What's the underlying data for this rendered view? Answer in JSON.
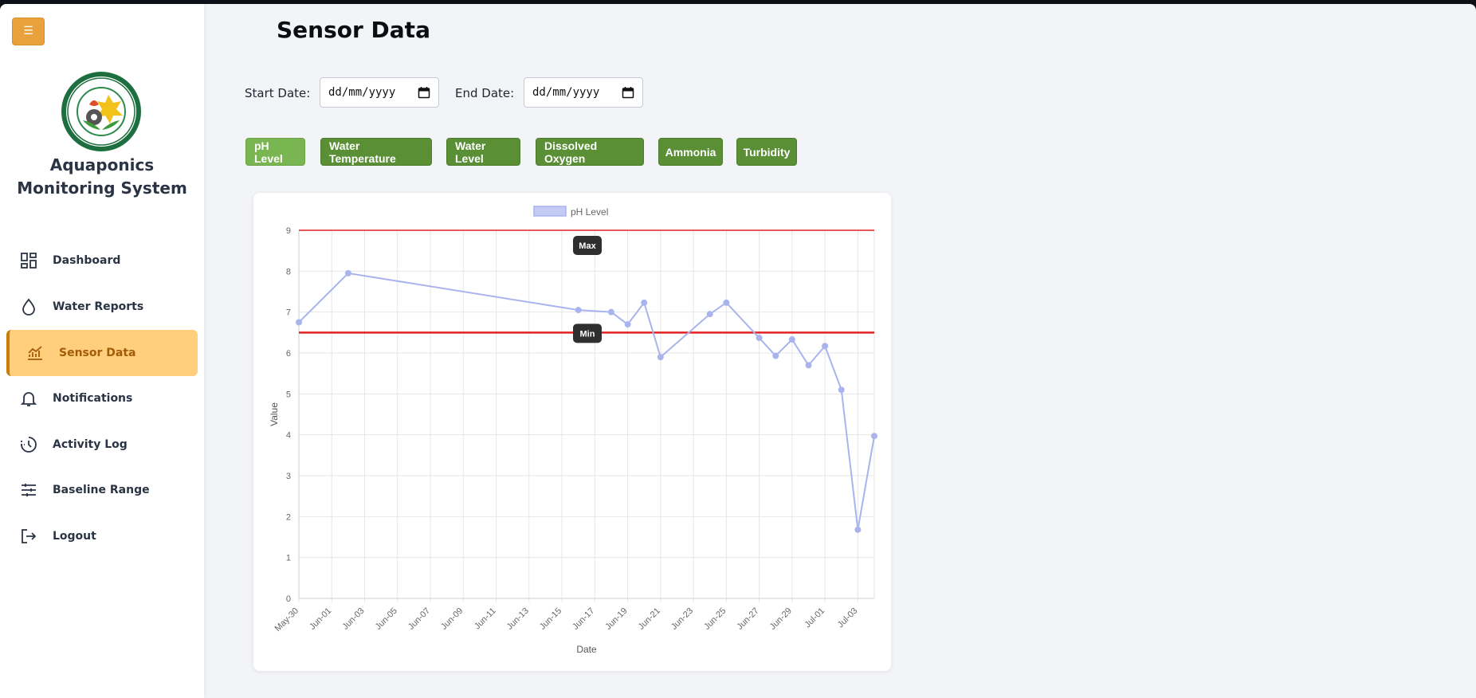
{
  "sidebar": {
    "toggle_glyph": "☰",
    "brand": "Aquaponics Monitoring System",
    "items": [
      {
        "label": "Dashboard",
        "icon": "dashboard-icon"
      },
      {
        "label": "Water Reports",
        "icon": "water-drop-icon"
      },
      {
        "label": "Sensor Data",
        "icon": "chart-icon",
        "active": true
      },
      {
        "label": "Notifications",
        "icon": "bell-icon"
      },
      {
        "label": "Activity Log",
        "icon": "history-icon"
      },
      {
        "label": "Baseline Range",
        "icon": "sliders-icon"
      },
      {
        "label": "Logout",
        "icon": "logout-icon"
      }
    ]
  },
  "main": {
    "title": "Sensor Data",
    "filters": {
      "start_label": "Start Date:",
      "start_value": "dd/mm/yyyy",
      "end_label": "End Date:",
      "end_value": "dd/mm/yyyy"
    },
    "sensor_buttons": [
      "pH Level",
      "Water Temperature",
      "Water Level",
      "Dissolved Oxygen",
      "Ammonia",
      "Turbidity"
    ],
    "active_sensor": "pH Level"
  },
  "colors": {
    "accent": "#e9a23b",
    "active_nav_bg": "#ffcf7e",
    "button_green": "#5a8f36",
    "button_active": "#79b550",
    "series": "#a9b4ee",
    "threshold": "#e22222"
  },
  "chart_data": {
    "type": "line",
    "legend": "pH Level",
    "xlabel": "Date",
    "ylabel": "Value",
    "ylim": [
      0,
      9
    ],
    "yticks": [
      0,
      1,
      2,
      3,
      4,
      5,
      6,
      7,
      8,
      9
    ],
    "x_range": [
      "2025-05-30",
      "2025-07-04"
    ],
    "x_ticks": [
      "May-30",
      "Jun-01",
      "Jun-03",
      "Jun-05",
      "Jun-07",
      "Jun-09",
      "Jun-11",
      "Jun-13",
      "Jun-15",
      "Jun-17",
      "Jun-19",
      "Jun-21",
      "Jun-23",
      "Jun-25",
      "Jun-27",
      "Jun-29",
      "Jul-01",
      "Jul-03"
    ],
    "points": [
      {
        "x": "2025-05-30",
        "y": 6.75
      },
      {
        "x": "2025-06-02",
        "y": 7.95
      },
      {
        "x": "2025-06-16",
        "y": 7.05
      },
      {
        "x": "2025-06-18",
        "y": 7.0
      },
      {
        "x": "2025-06-19",
        "y": 6.7
      },
      {
        "x": "2025-06-20",
        "y": 7.23
      },
      {
        "x": "2025-06-21",
        "y": 5.9
      },
      {
        "x": "2025-06-24",
        "y": 6.95
      },
      {
        "x": "2025-06-25",
        "y": 7.23
      },
      {
        "x": "2025-06-27",
        "y": 6.37
      },
      {
        "x": "2025-06-28",
        "y": 5.93
      },
      {
        "x": "2025-06-29",
        "y": 6.33
      },
      {
        "x": "2025-06-30",
        "y": 5.7
      },
      {
        "x": "2025-07-01",
        "y": 6.17
      },
      {
        "x": "2025-07-02",
        "y": 5.1
      },
      {
        "x": "2025-07-03",
        "y": 1.68
      },
      {
        "x": "2025-07-04",
        "y": 3.97
      }
    ],
    "thresholds": [
      {
        "label": "Max",
        "value": 9
      },
      {
        "label": "Min",
        "value": 6.5
      }
    ]
  }
}
